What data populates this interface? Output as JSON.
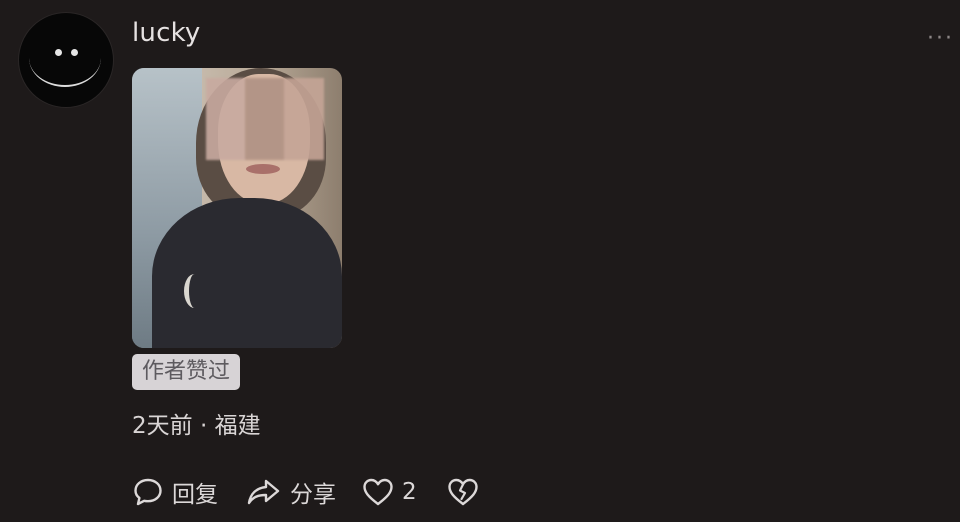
{
  "comment": {
    "username": "lucky",
    "more_label": "···",
    "badge": "作者赞过",
    "meta": "2天前 · 福建",
    "actions": {
      "reply_label": "回复",
      "share_label": "分享",
      "like_count": "2"
    }
  },
  "icons": {
    "reply": "speech-bubble-icon",
    "share": "share-arrow-icon",
    "like": "heart-outline-icon",
    "dislike": "broken-heart-icon"
  },
  "colors": {
    "background": "#1e1a1a",
    "badge_bg": "#d7d3d6",
    "text": "#e9e6e6"
  }
}
